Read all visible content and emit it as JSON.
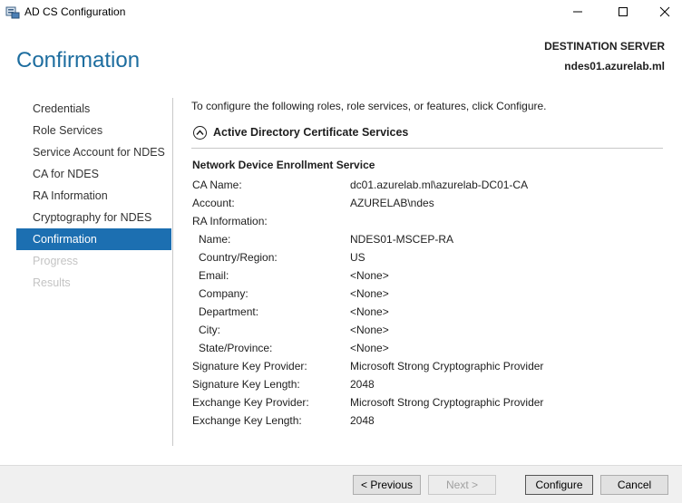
{
  "window": {
    "title": "AD CS Configuration"
  },
  "header": {
    "page_title": "Confirmation",
    "destination_label": "DESTINATION SERVER",
    "destination_server": "ndes01.azurelab.ml"
  },
  "nav": {
    "items": [
      {
        "label": "Credentials",
        "state": "normal"
      },
      {
        "label": "Role Services",
        "state": "normal"
      },
      {
        "label": "Service Account for NDES",
        "state": "normal"
      },
      {
        "label": "CA for NDES",
        "state": "normal"
      },
      {
        "label": "RA Information",
        "state": "normal"
      },
      {
        "label": "Cryptography for NDES",
        "state": "normal"
      },
      {
        "label": "Confirmation",
        "state": "active"
      },
      {
        "label": "Progress",
        "state": "disabled"
      },
      {
        "label": "Results",
        "state": "disabled"
      }
    ]
  },
  "main": {
    "intro": "To configure the following roles, role services, or features, click Configure.",
    "section_title": "Active Directory Certificate Services",
    "service_title": "Network Device Enrollment Service",
    "rows": [
      {
        "key": "CA Name:",
        "value": "dc01.azurelab.ml\\azurelab-DC01-CA",
        "indent": false
      },
      {
        "key": "Account:",
        "value": "AZURELAB\\ndes",
        "indent": false
      },
      {
        "key": "RA Information:",
        "value": "",
        "indent": false
      },
      {
        "key": "Name:",
        "value": "NDES01-MSCEP-RA",
        "indent": true
      },
      {
        "key": "Country/Region:",
        "value": "US",
        "indent": true
      },
      {
        "key": "Email:",
        "value": "<None>",
        "indent": true
      },
      {
        "key": "Company:",
        "value": "<None>",
        "indent": true
      },
      {
        "key": "Department:",
        "value": "<None>",
        "indent": true
      },
      {
        "key": "City:",
        "value": "<None>",
        "indent": true
      },
      {
        "key": "State/Province:",
        "value": "<None>",
        "indent": true
      },
      {
        "key": "Signature Key Provider:",
        "value": "Microsoft Strong Cryptographic Provider",
        "indent": false
      },
      {
        "key": "Signature Key Length:",
        "value": "2048",
        "indent": false
      },
      {
        "key": "Exchange Key Provider:",
        "value": "Microsoft Strong Cryptographic Provider",
        "indent": false
      },
      {
        "key": "Exchange Key Length:",
        "value": "2048",
        "indent": false
      }
    ]
  },
  "footer": {
    "previous_label": "< Previous",
    "next_label": "Next >",
    "configure_label": "Configure",
    "cancel_label": "Cancel"
  },
  "colors": {
    "accent": "#1c6fb1",
    "title": "#1d6d9f"
  }
}
